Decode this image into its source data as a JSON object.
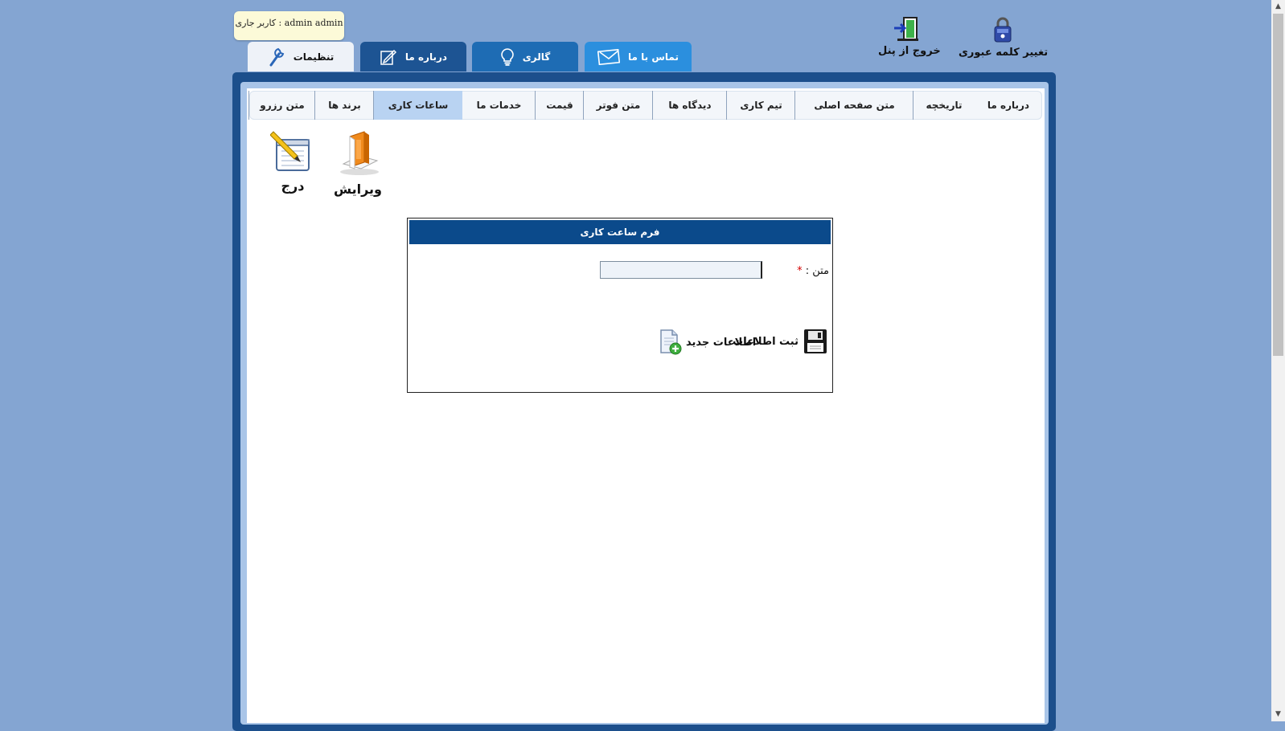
{
  "header": {
    "tools": {
      "change_password": "تغییر کلمه عبوری",
      "logout": "خروج از پنل"
    },
    "current_user": "admin admin : کاربر جاری"
  },
  "main_tabs": {
    "settings": "تنظیمات",
    "about": "درباره ما",
    "gallery": "گالری",
    "contact": "تماس با ما"
  },
  "sub_tabs": [
    "درباره ما",
    "تاریخچه",
    "متن صفحه اصلی",
    "تیم کاری",
    "دیدگاه ها",
    "متن فوتر",
    "قیمت",
    "خدمات ما",
    "ساعات کاری",
    "برند ها",
    "متن رزرو"
  ],
  "active_sub_tab": "ساعات کاری",
  "actions": {
    "edit": "ویرایش",
    "insert": "درج"
  },
  "form": {
    "title": "فرم ساعت کاری",
    "field_label": "متن :",
    "field_required_mark": "*",
    "field_value": "",
    "save_button": "ثبت اطلاعات",
    "new_button": "اطلاعات جدید"
  },
  "colors": {
    "page_bg": "#84a5d2",
    "frame": "#1c4f8c",
    "form_header": "#0b4a8b",
    "active_subtab": "#b9d3f2"
  }
}
